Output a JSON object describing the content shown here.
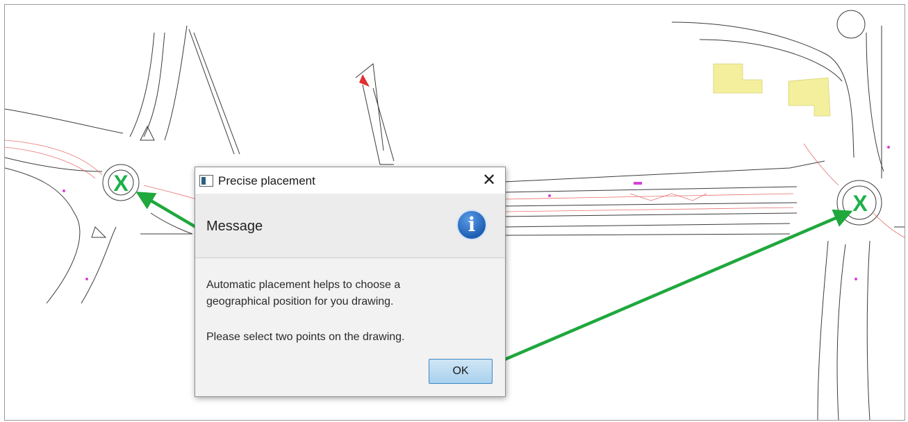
{
  "dialog": {
    "title": "Precise placement",
    "close_glyph": "✕",
    "header_label": "Message",
    "info_icon_glyph": "i",
    "text_line1": "Automatic placement helps to choose a",
    "text_line2": "geographical position for you drawing.",
    "text_line3": "Please select two points on the drawing.",
    "ok_label": "OK"
  },
  "markers": {
    "left_label": "X",
    "right_label": "X"
  },
  "colors": {
    "arrow": "#1fa83c",
    "marker": "#1db04a",
    "hatch": "#f3ef9c",
    "red_lines": "#e24a4a",
    "magenta": "#d640d6",
    "ok_border": "#3d87c6"
  }
}
